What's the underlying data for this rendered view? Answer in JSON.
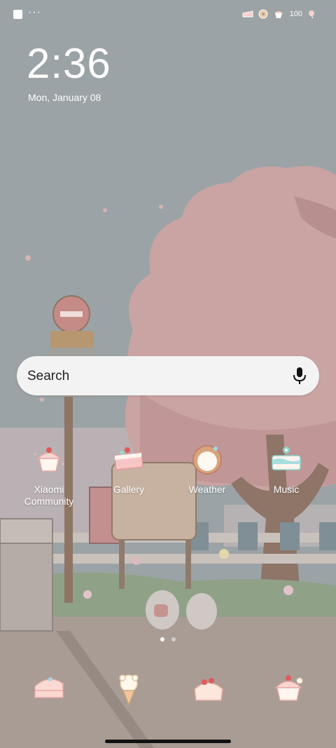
{
  "status_bar": {
    "left_icons": [
      "notification-square-icon",
      "more-dots-icon"
    ],
    "more_dots": "···",
    "right_icons": [
      "cake-slice-icon",
      "donut-icon",
      "cupcake-icon"
    ],
    "battery": "100",
    "battery_icon": "sweet-battery-icon"
  },
  "lockscreen": {
    "time": "2:36",
    "date": "Mon, January 08"
  },
  "search": {
    "placeholder": "Search",
    "mic_icon": "microphone-icon"
  },
  "apps": [
    {
      "label": "Xiaomi Community",
      "icon": "cupcake-cherry-icon"
    },
    {
      "label": "Gallery",
      "icon": "strawberry-cake-icon"
    },
    {
      "label": "Weather",
      "icon": "donut-ring-icon"
    },
    {
      "label": "Music",
      "icon": "layer-cake-icon"
    }
  ],
  "pager": {
    "pages": 2,
    "active": 1
  },
  "dock": [
    {
      "icon": "cake-slice-icon"
    },
    {
      "icon": "ice-cream-cone-icon"
    },
    {
      "icon": "cherry-cake-icon"
    },
    {
      "icon": "bear-cupcake-icon"
    }
  ],
  "colors": {
    "sky": "#9aa3a6",
    "tree_pink": "#caa4a2",
    "ground": "#a99b93",
    "search_bg": "#f3f3f3",
    "accent_pink": "#f2b9b8"
  }
}
